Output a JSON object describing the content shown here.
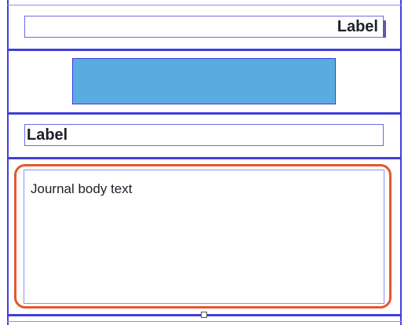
{
  "header_label": {
    "text": "Label",
    "alignment": "right"
  },
  "image_view": {
    "fill_color": "#5aabe0"
  },
  "title_label": {
    "text": "Label",
    "alignment": "left"
  },
  "body_text_view": {
    "text": "Journal body text"
  },
  "colors": {
    "guide": "#3f3fd9",
    "selection": "#e5562e",
    "image_fill": "#5aabe0"
  }
}
